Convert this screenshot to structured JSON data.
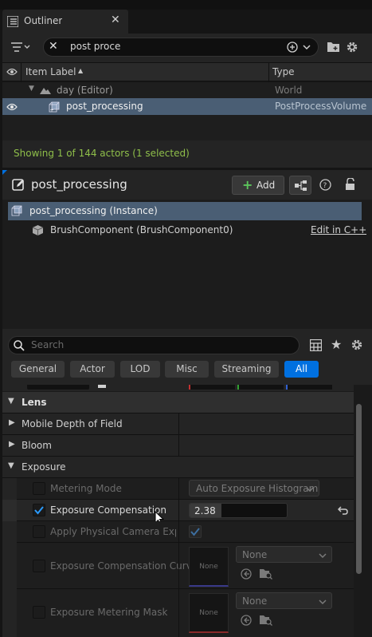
{
  "window": {
    "top_partial_bar": ""
  },
  "outliner": {
    "tab_title": "Outliner",
    "search_value": "post proce",
    "columns": {
      "label": "Item Label",
      "type": "Type"
    },
    "rows": [
      {
        "label": "day (Editor)",
        "type": "World"
      },
      {
        "label": "post_processing",
        "type": "PostProcessVolume"
      }
    ],
    "status": "Showing 1 of 144 actors (1 selected)"
  },
  "details": {
    "title": "post_processing",
    "add_label": "Add",
    "instance_label": "post_processing (Instance)",
    "component_label": "BrushComponent (BrushComponent0)",
    "edit_link": "Edit in C++",
    "search_placeholder": "Search",
    "filter_tabs": [
      "General",
      "Actor",
      "LOD",
      "Misc",
      "Streaming",
      "All"
    ],
    "active_filter": "All",
    "sections": {
      "lens": "Lens",
      "mobile_dof": "Mobile Depth of Field",
      "bloom": "Bloom",
      "exposure": "Exposure"
    },
    "props": {
      "metering_mode": {
        "label": "Metering Mode",
        "value": "Auto Exposure Histogram"
      },
      "exposure_comp": {
        "label": "Exposure Compensation",
        "value": "2.38",
        "fraction": 0.33
      },
      "apply_physical": {
        "label": "Apply Physical Camera Expos..."
      },
      "comp_curve": {
        "label": "Exposure Compensation Curve",
        "thumb": "None",
        "dropdown": "None"
      },
      "metering_mask": {
        "label": "Exposure Metering Mask",
        "thumb": "None",
        "dropdown": "None"
      }
    }
  },
  "colors": {
    "accent": "#0070e0",
    "status_green": "#8fbf4a",
    "selected_row": "#4a5e74"
  }
}
